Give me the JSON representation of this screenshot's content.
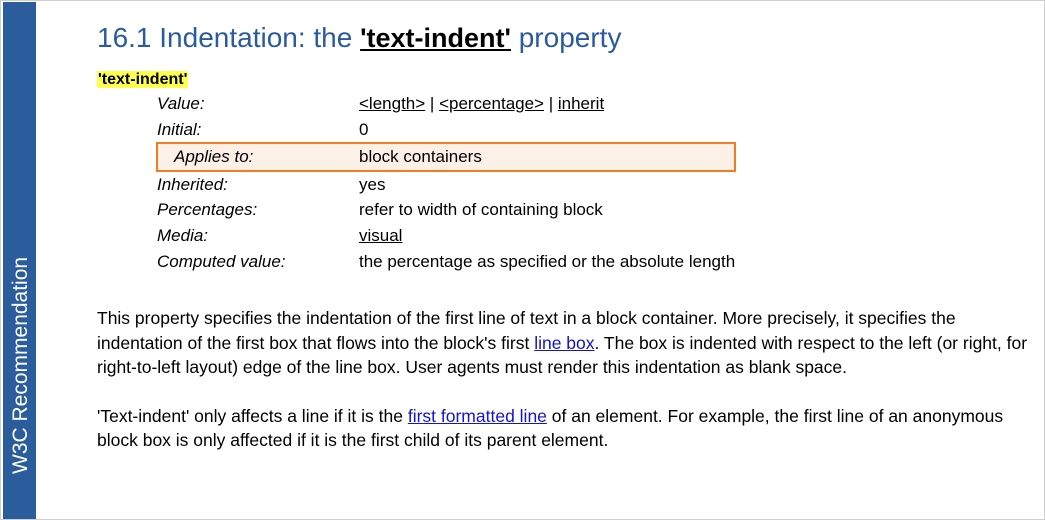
{
  "sidebar": {
    "label": "W3C Recommendation",
    "background_color": "#2b5c9b",
    "text_color": "#ffffff"
  },
  "heading": {
    "prefix": "16.1 Indentation: the ",
    "property": "'text-indent'",
    "suffix": " property",
    "color": "#2a5ba0"
  },
  "property_block": {
    "name": "'text-indent'",
    "highlight_color": "#ffff4d",
    "rows": [
      {
        "label": "Value:",
        "value": "<length> | <percentage> | inherit",
        "value_parts": [
          {
            "text": "<length>",
            "underline": true
          },
          {
            "text": " | ",
            "underline": false
          },
          {
            "text": "<percentage>",
            "underline": true
          },
          {
            "text": " | ",
            "underline": false
          },
          {
            "text": "inherit",
            "underline": true
          }
        ],
        "highlighted": false
      },
      {
        "label": "Initial:",
        "value": "0",
        "highlighted": false
      },
      {
        "label": "Applies to:",
        "value": "block containers",
        "highlighted": true
      },
      {
        "label": "Inherited:",
        "value": "yes",
        "highlighted": false
      },
      {
        "label": "Percentages:",
        "value": "refer to width of containing block",
        "highlighted": false
      },
      {
        "label": "Media:",
        "value": "visual",
        "highlighted": false,
        "value_underlined": true
      },
      {
        "label": "Computed value:",
        "value": "the percentage as specified or the absolute length",
        "highlighted": false
      }
    ],
    "callout": {
      "border_color": "#f47c20",
      "fill_color": "#fdf0e6"
    }
  },
  "paragraphs": {
    "p1": {
      "part_1": "This property specifies the indentation of the first line of text in a block container. More precisely, it specifies the indentation of the first box that flows into the block's first ",
      "link_1": "line box",
      "part_2": ". The box is indented with respect to the left (or right, for right-to-left layout) edge of the line box. User agents must render this indentation as blank space."
    },
    "p2": {
      "part_1": "'Text-indent' only affects a line if it is the ",
      "link_1": "first formatted line",
      "part_2": " of an element. For example, the first line of an anonymous block box is only affected if it is the first child of its parent element."
    }
  },
  "link_color": "#1414cc"
}
